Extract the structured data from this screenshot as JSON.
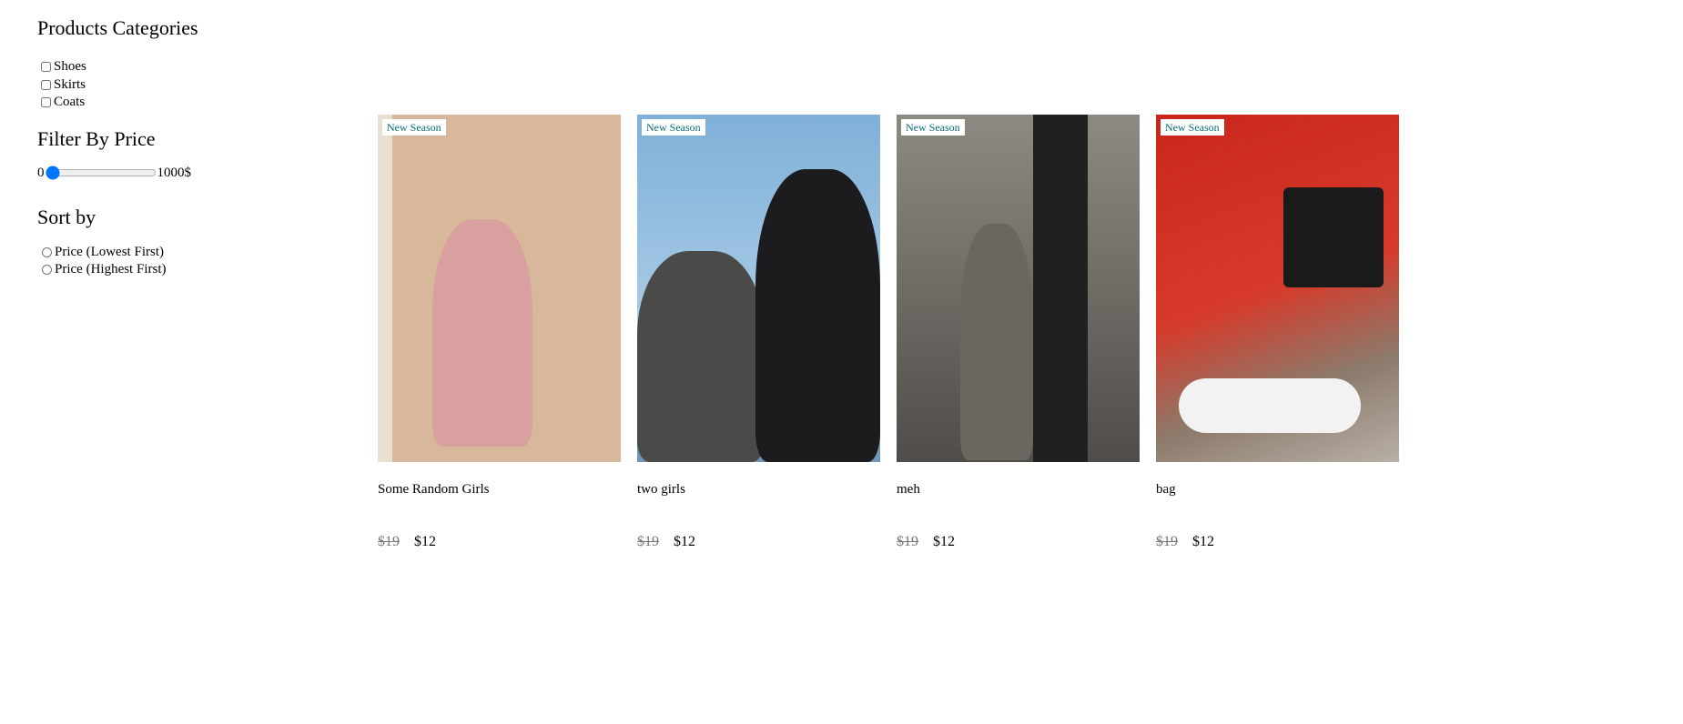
{
  "sidebar": {
    "categories_title": "Products Categories",
    "categories": [
      "Shoes",
      "Skirts",
      "Coats"
    ],
    "price_title": "Filter By Price",
    "price_min_label": "0",
    "price_max_label": "1000$",
    "price_value": 0,
    "sort_title": "Sort by",
    "sort_options": [
      "Price (Lowest First)",
      "Price (Highest First)"
    ]
  },
  "products": [
    {
      "badge": "New Season",
      "title": "Some Random Girls",
      "old_price": "$19",
      "price": "$12"
    },
    {
      "badge": "New Season",
      "title": "two girls",
      "old_price": "$19",
      "price": "$12"
    },
    {
      "badge": "New Season",
      "title": "meh",
      "old_price": "$19",
      "price": "$12"
    },
    {
      "badge": "New Season",
      "title": "bag",
      "old_price": "$19",
      "price": "$12"
    }
  ]
}
